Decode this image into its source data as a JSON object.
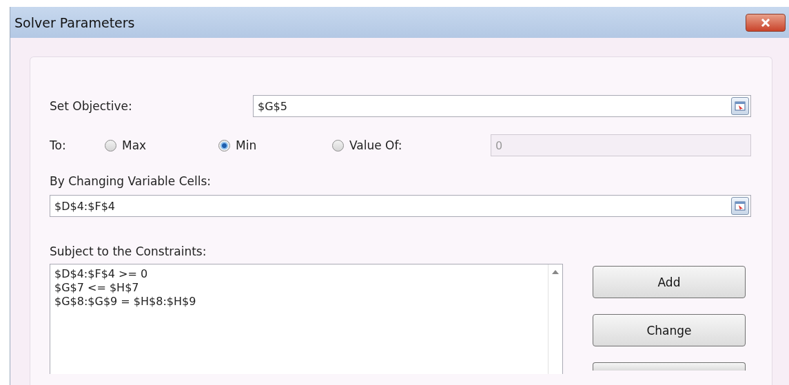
{
  "window": {
    "title": "Solver Parameters"
  },
  "objective": {
    "label": "Set Objective:",
    "value": "$G$5"
  },
  "to": {
    "label": "To:",
    "options": [
      {
        "label": "Max",
        "selected": false
      },
      {
        "label": "Min",
        "selected": true
      },
      {
        "label": "Value Of:",
        "selected": false
      }
    ],
    "value_field": {
      "value": "0",
      "disabled": true
    }
  },
  "variable_cells": {
    "label": "By Changing Variable Cells:",
    "value": "$D$4:$F$4"
  },
  "constraints": {
    "label": "Subject to the Constraints:",
    "items": [
      "$D$4:$F$4 >= 0",
      "$G$7 <= $H$7",
      "$G$8:$G$9 = $H$8:$H$9"
    ]
  },
  "buttons": [
    "Add",
    "Change"
  ]
}
